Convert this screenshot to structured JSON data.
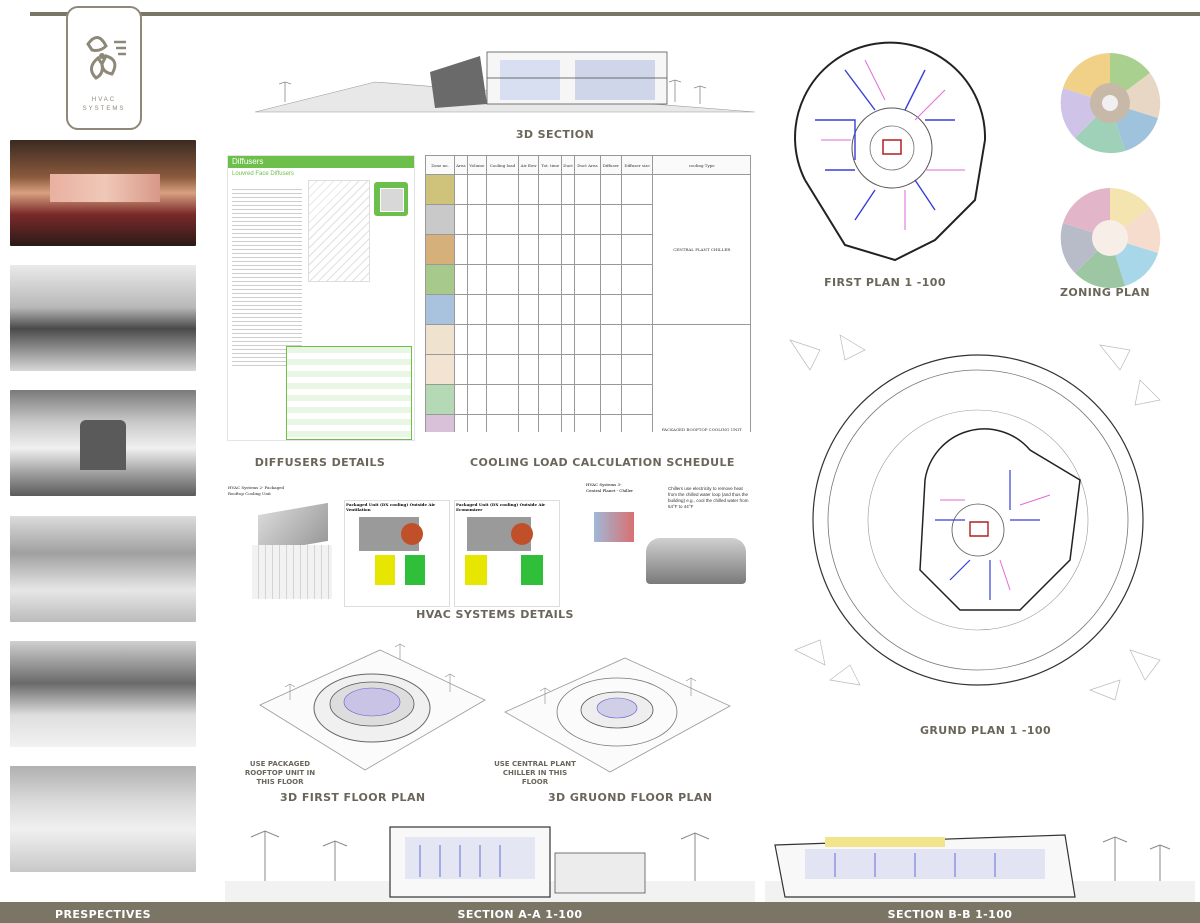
{
  "logo": {
    "title": "HVAC SYSTEMS"
  },
  "colors": {
    "bar": "#7a7565",
    "heading": "#6b665a",
    "diffuser_green": "#6bbf4a",
    "duct_blue": "#3a3fd6",
    "duct_pink": "#e06ad8"
  },
  "sections": {
    "section_3d": "3D SECTION",
    "diffusers": "DIFFUSERS DETAILS",
    "cooling": "COOLING LOAD CALCULATION SCHEDULE",
    "hvac": "HVAC SYSTEMS DETAILS",
    "floor3d_first": "3D FIRST FLOOR PLAN",
    "floor3d_ground": "3D GRUOND FLOOR PLAN",
    "first_plan": "FIRST PLAN 1 -100",
    "zoning": "ZONING PLAN",
    "ground_plan": "GRUND PLAN 1 -100",
    "prespectives": "PRESPECTIVES",
    "section_aa": "SECTION A-A 1-100",
    "section_bb": "SECTION B-B 1-100"
  },
  "notes": {
    "rooftop": "USE PACKAGED ROOFTOP UNIT IN THIS FLOOR",
    "chiller": "USE CENTRAL PLANT CHILLER IN THIS FLOOR"
  },
  "diffuser_sheet": {
    "title": "Diffusers",
    "subtitle": "Louvred Face Diffusers"
  },
  "hvac_panels": {
    "left": "HVAC Systems 2- Packaged Rooftop Cooling Unit",
    "mid1": "Packaged Unit (DX cooling) Outside Air Ventilation",
    "mid2": "Packaged Unit (DX cooling) Outside Air Economizer",
    "right_title": "HVAC Systems 3- Central Planet - Chiller",
    "right_note": "Chillers use electricity to remove heat from the chilled water loop (and thus the building) e.g., cool the chilled water from 54°F to 44°F"
  },
  "cooling_table": {
    "zone_colors": [
      "#cfc27a",
      "#c9c9c9",
      "#d6b07a",
      "#a8c98c",
      "#a9c2dd",
      "#efe2cf",
      "#f2e3d2",
      "#b5d9b5",
      "#d9c2d9",
      "#e2a8b0",
      "#d9e8b8",
      "#d8d4ee"
    ],
    "groups": [
      "CENTRAL PLANT CHILLER",
      "PACKAGED ROOFTOP COOLING UNIT"
    ]
  }
}
